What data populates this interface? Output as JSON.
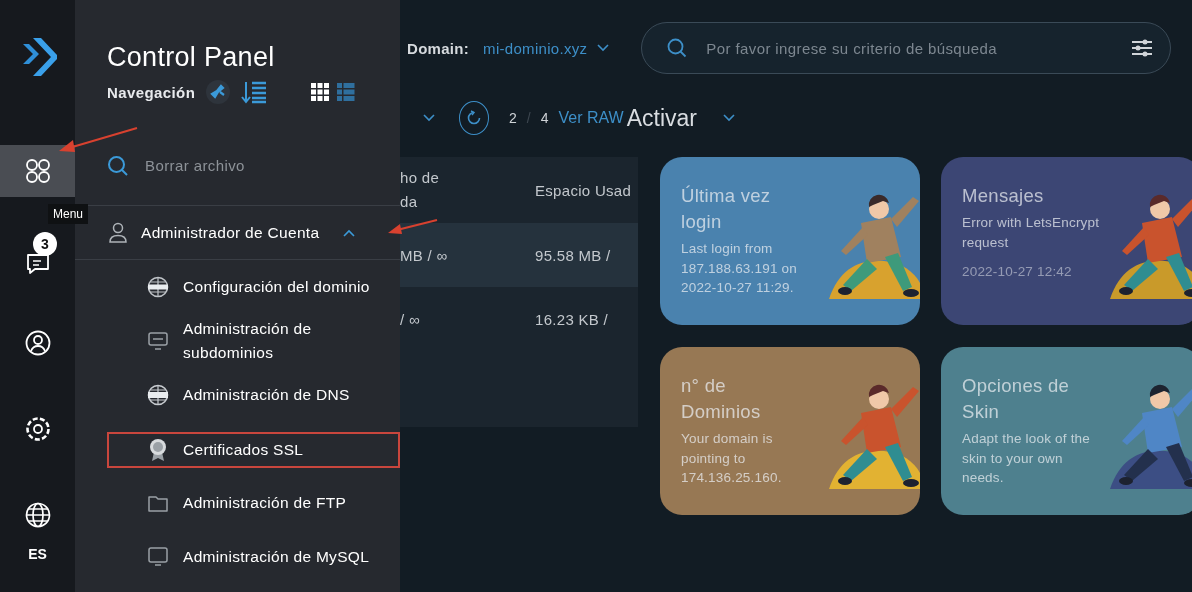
{
  "rail": {
    "items": [
      {
        "kind": "menu",
        "selected": true,
        "tooltip": "Menu"
      },
      {
        "kind": "chat",
        "selected": false,
        "badge": "3"
      },
      {
        "kind": "user",
        "selected": false
      },
      {
        "kind": "settings",
        "selected": false
      },
      {
        "kind": "language",
        "selected": false,
        "label": "ES"
      }
    ]
  },
  "nav_panel": {
    "title": "Control Panel",
    "subtitle": "Navegación",
    "view_toggle": [
      {
        "kind": "grid",
        "selected": true
      },
      {
        "kind": "list",
        "selected": false
      }
    ],
    "search": {
      "placeholder": "Borrar archivo"
    },
    "section": {
      "label": "Administrador de Cuenta",
      "expanded": true,
      "items": [
        {
          "label": "Configuración del dominio",
          "kind": "www",
          "highlighted": false
        },
        {
          "label": "Administración de subdominios",
          "kind": "monitor",
          "highlighted": false
        },
        {
          "label": "Administración de DNS",
          "kind": "dns",
          "highlighted": false
        },
        {
          "label": "Certificados SSL",
          "kind": "ssl",
          "highlighted": true
        },
        {
          "label": "Administración de FTP",
          "kind": "ftp",
          "highlighted": false
        },
        {
          "label": "Administración de MySQL",
          "kind": "sql",
          "highlighted": false
        }
      ]
    }
  },
  "main": {
    "domain": {
      "label": "Domain:",
      "value": "mi-dominio.xyz"
    },
    "search": {
      "placeholder": "Por favor ingrese su criterio de búsqueda"
    },
    "toolbar": {
      "page": "2",
      "separator": "/",
      "total": "4",
      "raw_link": "Ver RAW",
      "action": "Activar"
    },
    "table": {
      "columns": [
        "ho de da",
        "Espacio Usad"
      ],
      "rows": [
        {
          "cells": [
            "MB / ∞",
            "95.58 MB /"
          ],
          "hovered": true
        },
        {
          "cells": [
            "/ ∞",
            "16.23 KB /"
          ],
          "hovered": false
        }
      ]
    },
    "cards": [
      {
        "title": "Última vez login",
        "text": "Last login from 187.188.63.191 on 2022-10-27 11:29.",
        "color": "#4a82ae"
      },
      {
        "title": "Mensajes",
        "text": "Error with LetsEncrypt request",
        "date": "2022-10-27 12:42",
        "color": "#3c4674"
      },
      {
        "title": "n° de Dominios",
        "text": "Your domain is pointing to 174.136.25.160.",
        "color": "#977854"
      },
      {
        "title": "Opciones de Skin",
        "text": "Adapt the look of the skin to your own needs.",
        "color": "#4e808e"
      }
    ]
  }
}
